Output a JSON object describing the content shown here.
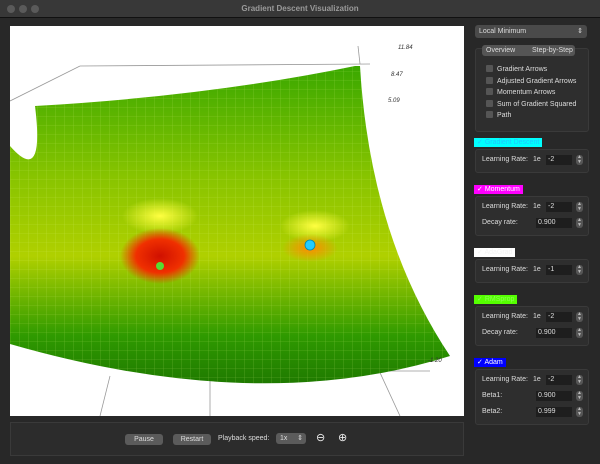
{
  "window": {
    "title": "Gradient Descent Visualization"
  },
  "plot": {
    "z_ticks": [
      "11.84",
      "8.47",
      "5.09"
    ],
    "x_tick": "-1.20"
  },
  "controls": {
    "pause": "Pause",
    "restart": "Restart",
    "speed_label": "Playback speed:",
    "speed_value": "1x",
    "zoom_out_icon": "zoom-out-icon",
    "zoom_in_icon": "zoom-in-icon"
  },
  "sidebar": {
    "scenario": "Local Minimum",
    "tabs": [
      "Overview",
      "Step-by-Step"
    ],
    "options": [
      "Gradient Arrows",
      "Adjusted Gradient Arrows",
      "Momentum Arrows",
      "Sum of Gradient Squared",
      "Path"
    ],
    "optimizers": [
      {
        "name": "Gradient Descent",
        "color": "#00ffff",
        "text_color": "#1fc8ff",
        "checked": true,
        "params": [
          {
            "label": "Learning Rate:",
            "prefix": "1e",
            "value": "-2"
          }
        ]
      },
      {
        "name": "Momentum",
        "color": "#ff00ff",
        "text_color": "#ffffff",
        "checked": true,
        "params": [
          {
            "label": "Learning Rate:",
            "prefix": "1e",
            "value": "-2"
          },
          {
            "label": "Decay rate:",
            "prefix": "",
            "value": "0.900"
          }
        ]
      },
      {
        "name": "AdaGrad",
        "color": "#ffffff",
        "text_color": "#f4f4f4",
        "checked": true,
        "params": [
          {
            "label": "Learning Rate:",
            "prefix": "1e",
            "value": "-1"
          }
        ]
      },
      {
        "name": "RMSprop",
        "color": "#55ff00",
        "text_color": "#88ff55",
        "checked": true,
        "params": [
          {
            "label": "Learning Rate:",
            "prefix": "1e",
            "value": "-2"
          },
          {
            "label": "Decay rate:",
            "prefix": "",
            "value": "0.900"
          }
        ]
      },
      {
        "name": "Adam",
        "color": "#0000ff",
        "text_color": "#ffffff",
        "checked": true,
        "params": [
          {
            "label": "Learning Rate:",
            "prefix": "1e",
            "value": "-2"
          },
          {
            "label": "Beta1:",
            "prefix": "",
            "value": "0.900"
          },
          {
            "label": "Beta2:",
            "prefix": "",
            "value": "0.999"
          }
        ]
      }
    ]
  }
}
